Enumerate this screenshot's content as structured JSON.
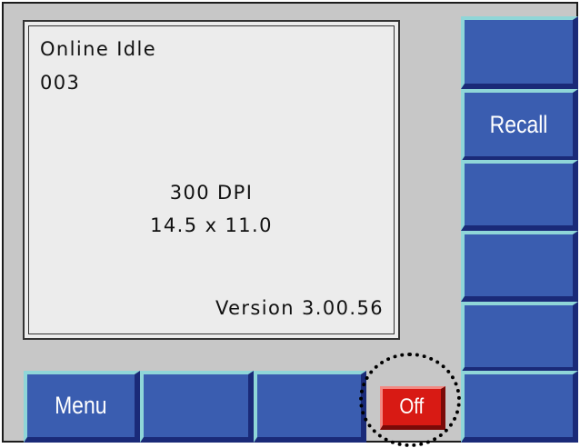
{
  "display": {
    "status": "Online Idle",
    "code": "003",
    "resolution": "300 DPI",
    "media_size": "14.5 x 11.0",
    "version": "Version 3.00.56"
  },
  "right_keys": [
    "",
    "Recall",
    "",
    "",
    "",
    ""
  ],
  "bottom_keys": [
    "Menu",
    "",
    ""
  ],
  "off_key": "Off",
  "colors": {
    "key_face": "#3a5db0",
    "key_highlight": "#8fd6d8",
    "key_shadow": "#1a2a78",
    "off_key": "#d81a14",
    "panel": "#c7c7c7",
    "screen": "#ececec"
  }
}
